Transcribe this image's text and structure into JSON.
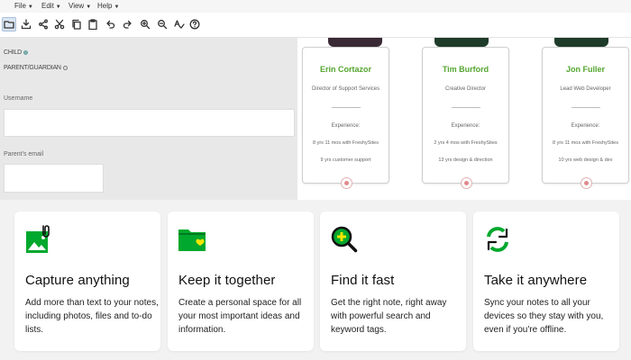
{
  "menubar": {
    "items": [
      {
        "label": "File"
      },
      {
        "label": "Edit"
      },
      {
        "label": "View"
      },
      {
        "label": "Help"
      }
    ]
  },
  "toolbar": {
    "icons": [
      "open-icon",
      "save-icon",
      "share-icon",
      "cut-icon",
      "copy-icon",
      "paste-icon",
      "undo-icon",
      "redo-icon",
      "zoom-in-icon",
      "zoom-out-icon",
      "spell-check-icon",
      "help-icon"
    ]
  },
  "form": {
    "radio_child": "CHILD",
    "radio_parent": "PARENT/GUARDIAN",
    "username_label": "Username",
    "username_value": "",
    "parent_email_label": "Parent's email",
    "parent_email_value": ""
  },
  "team": [
    {
      "name": "Erin Cortazor",
      "role": "Director of Support Services",
      "experience_label": "Experience:",
      "line1": "8 yrs 11 mos with FreshySites",
      "line2": "9 yrs customer support"
    },
    {
      "name": "Tim Burford",
      "role": "Creative Director",
      "experience_label": "Experience:",
      "line1": "2 yrs 4 mos with FreshySites",
      "line2": "13 yrs design & direction"
    },
    {
      "name": "Jon Fuller",
      "role": "Lead Web Developer",
      "experience_label": "Experience:",
      "line1": "8 yrs 11 mos with FreshySites",
      "line2": "10 yrs web design & dev"
    }
  ],
  "features": [
    {
      "icon": "image-clip-icon",
      "title": "Capture anything",
      "text": "Add more than text to your notes, including photos, files and to-do lists."
    },
    {
      "icon": "folder-heart-icon",
      "title": "Keep it together",
      "text": "Create a personal space for all your most important ideas and information."
    },
    {
      "icon": "magnifier-icon",
      "title": "Find it fast",
      "text": "Get the right note, right away with powerful search and keyword tags."
    },
    {
      "icon": "sync-icon",
      "title": "Take it anywhere",
      "text": "Sync your notes to all your devices so they stay with you, even if you're offline."
    }
  ],
  "colors": {
    "brand_green": "#00a82d",
    "name_green": "#55a630",
    "badge_pink": "#e08a8a"
  }
}
